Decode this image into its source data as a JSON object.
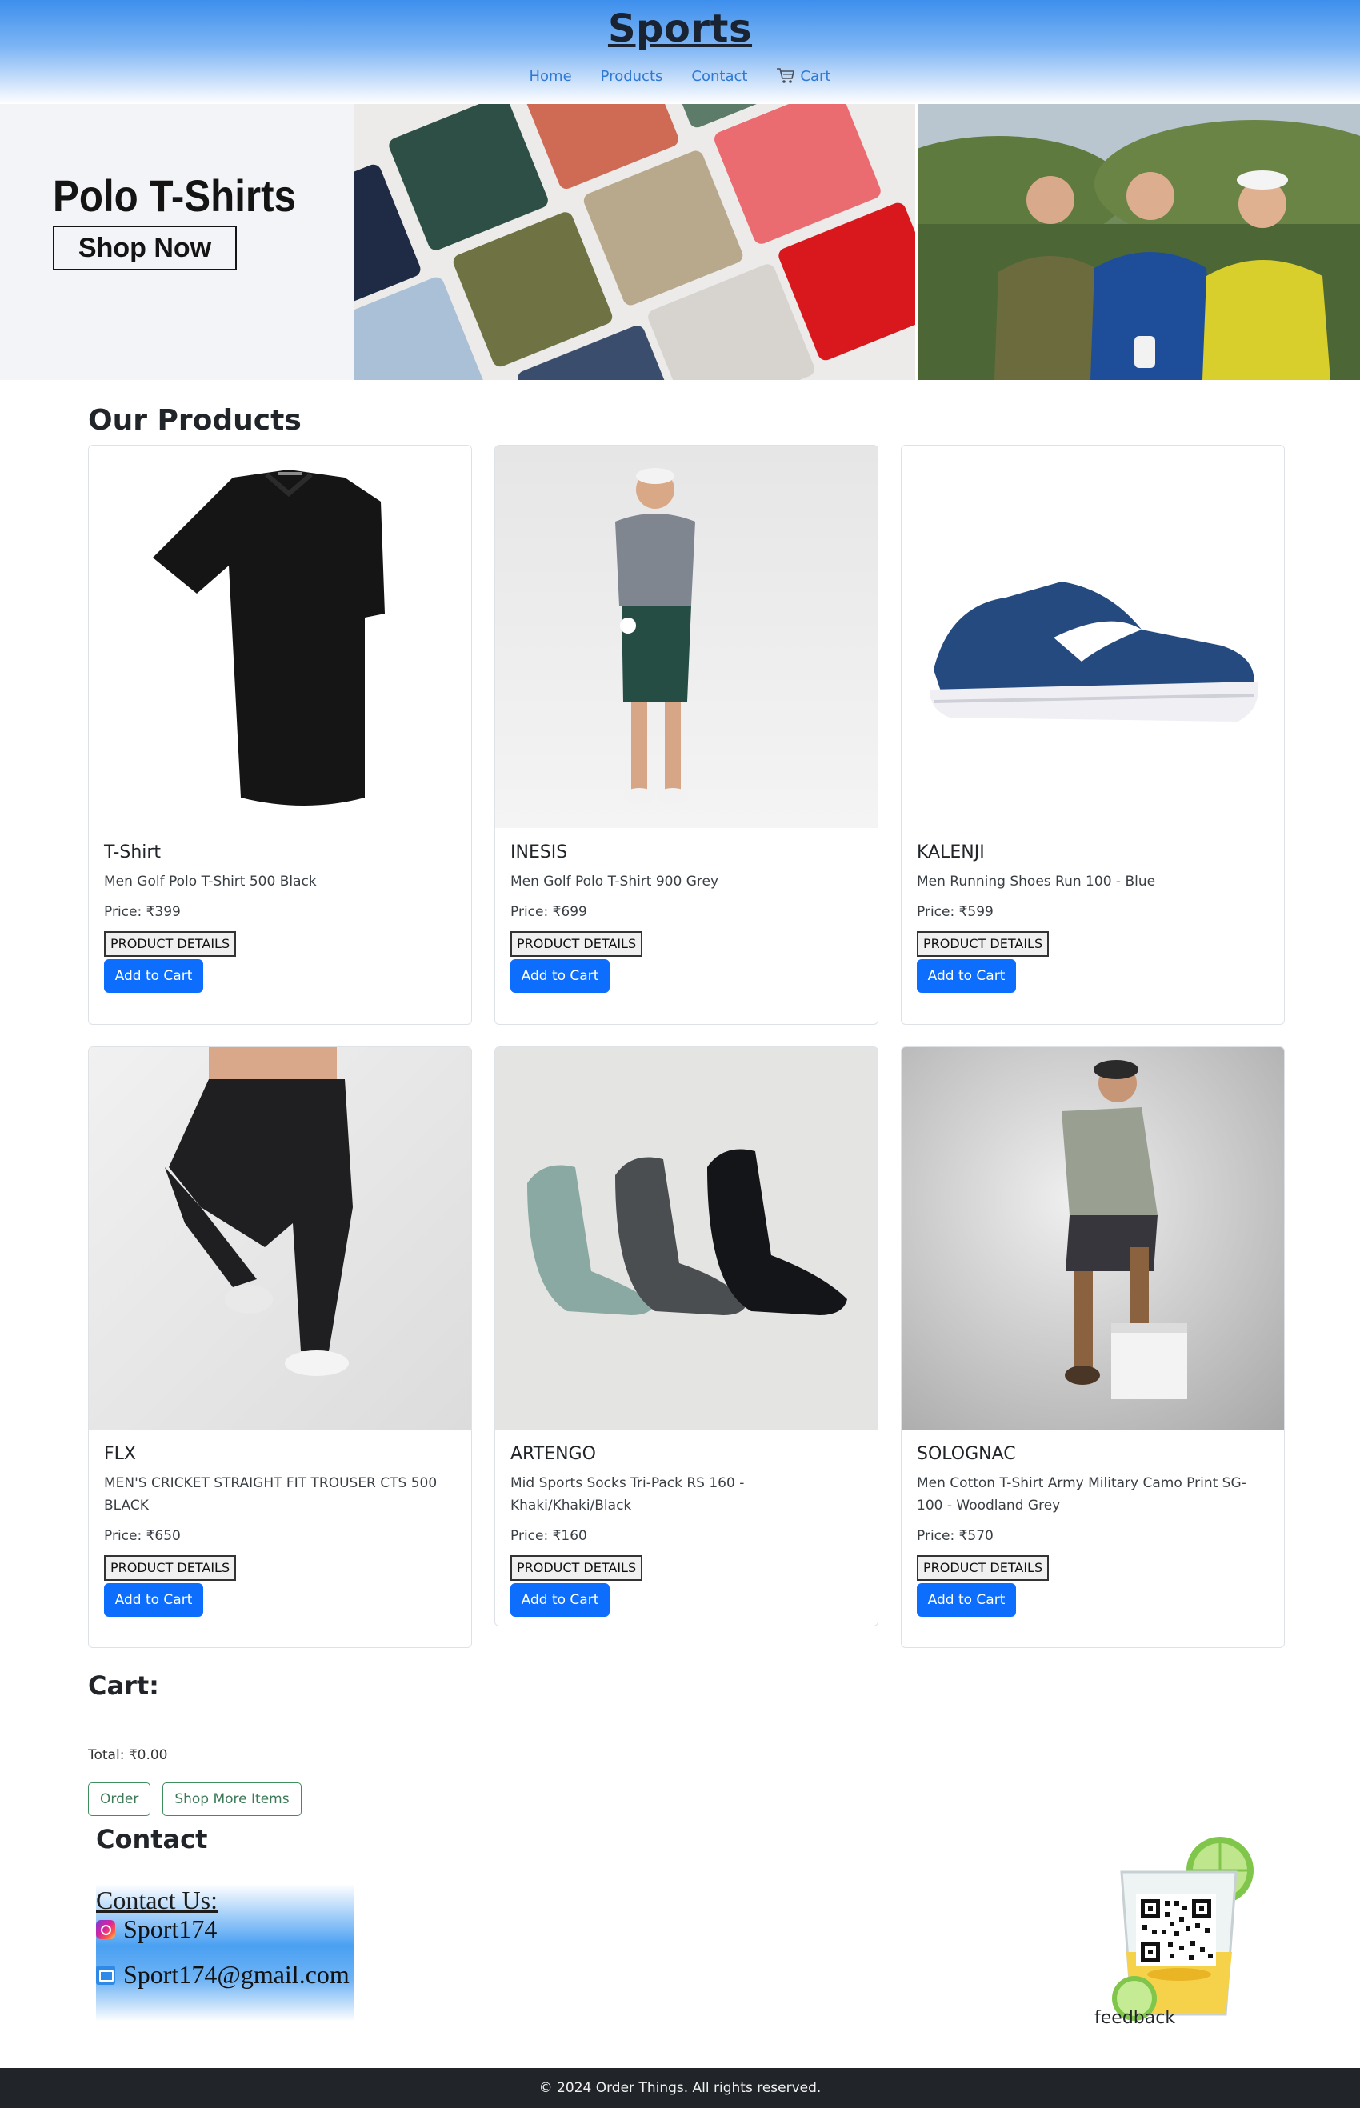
{
  "header": {
    "title": "Sports",
    "nav": {
      "home": "Home",
      "products": "Products",
      "contact": "Contact",
      "cart": "Cart",
      "cart_icon": "cart-icon"
    }
  },
  "banner": {
    "title": "Polo T-Shirts",
    "cta": "Shop Now"
  },
  "products": {
    "section_title": "Our Products",
    "details_label": "PRODUCT DETAILS",
    "add_label": "Add to Cart",
    "items": [
      {
        "name": "T-Shirt",
        "desc": "Men Golf Polo T-Shirt 500 Black",
        "price": "Price: ₹399"
      },
      {
        "name": "INESIS",
        "desc": "Men Golf Polo T-Shirt 900 Grey",
        "price": "Price: ₹699"
      },
      {
        "name": "KALENJI",
        "desc": "Men Running Shoes Run 100 - Blue",
        "price": "Price: ₹599"
      },
      {
        "name": "FLX",
        "desc": "MEN'S CRICKET STRAIGHT FIT TROUSER CTS 500 BLACK",
        "price": "Price: ₹650"
      },
      {
        "name": "ARTENGO",
        "desc": "Mid Sports Socks Tri-Pack RS 160 - Khaki/Khaki/Black",
        "price": "Price: ₹160"
      },
      {
        "name": "SOLOGNAC",
        "desc": "Men Cotton T-Shirt Army Military Camo Print SG-100 - Woodland Grey",
        "price": "Price: ₹570"
      }
    ]
  },
  "cart": {
    "title": "Cart:",
    "total": "Total: ₹0.00",
    "order_label": "Order",
    "shop_more_label": "Shop More Items"
  },
  "contact": {
    "title": "Contact",
    "heading": "Contact Us:",
    "instagram": "Sport174",
    "email": "Sport174@gmail.com"
  },
  "feedback": {
    "label": "feedback"
  },
  "footer": {
    "copyright": "© 2024 Order Things. All rights reserved."
  },
  "colors": {
    "primary_button": "#0d6efd",
    "header_gradient": "#3d8fed",
    "footer_bg": "#212529",
    "outline_green": "#3f8f5d"
  }
}
